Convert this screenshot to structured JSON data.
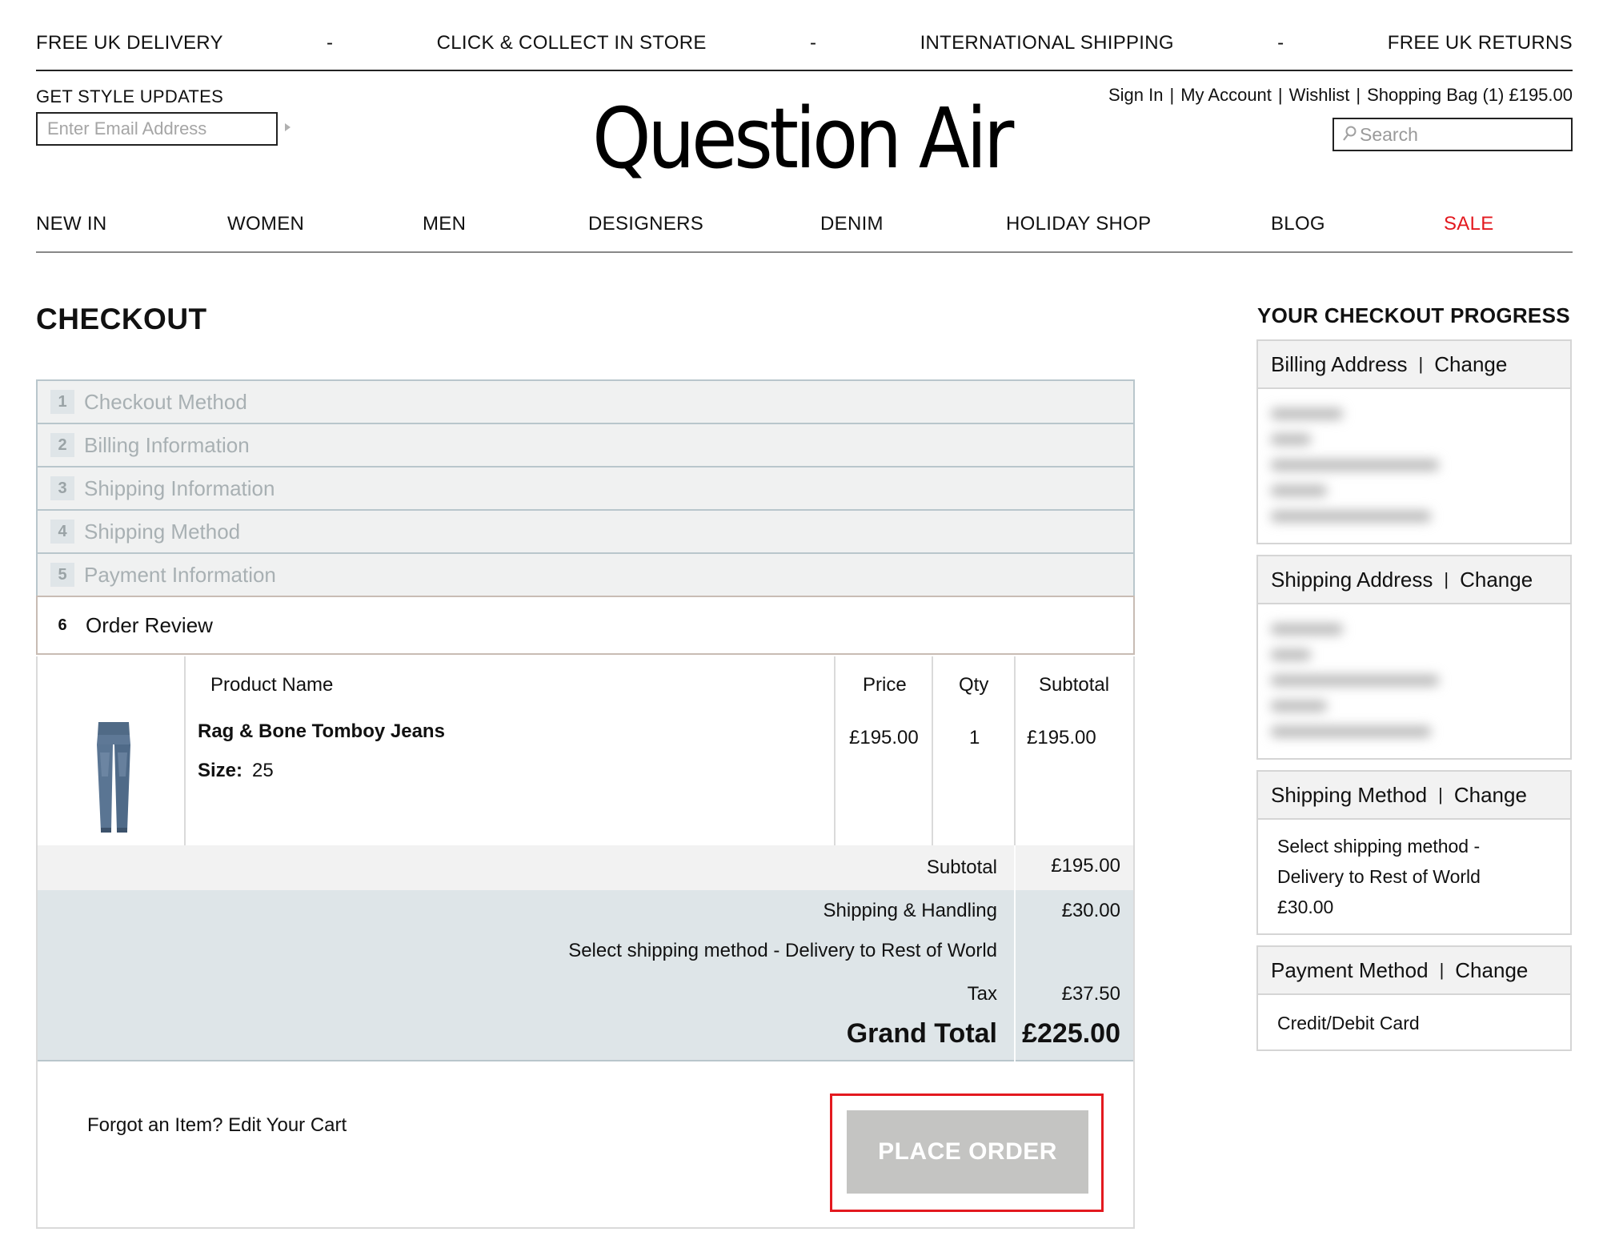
{
  "promo": {
    "items": [
      "FREE UK DELIVERY",
      "CLICK & COLLECT IN STORE",
      "INTERNATIONAL SHIPPING",
      "FREE UK RETURNS"
    ],
    "separator": "-"
  },
  "newsletter": {
    "label": "GET STYLE UPDATES",
    "placeholder": "Enter Email Address"
  },
  "brand": {
    "logo": "Question Air"
  },
  "account": {
    "sign_in": "Sign In",
    "my_account": "My Account",
    "wishlist": "Wishlist",
    "bag": "Shopping Bag (1) £195.00",
    "separator": "|"
  },
  "search": {
    "placeholder": "Search"
  },
  "nav": {
    "items": [
      {
        "label": "NEW IN"
      },
      {
        "label": "WOMEN"
      },
      {
        "label": "MEN"
      },
      {
        "label": "DESIGNERS"
      },
      {
        "label": "DENIM"
      },
      {
        "label": "HOLIDAY SHOP"
      },
      {
        "label": "BLOG"
      },
      {
        "label": "SALE"
      }
    ]
  },
  "checkout": {
    "title": "CHECKOUT",
    "steps": [
      {
        "num": "1",
        "label": "Checkout Method"
      },
      {
        "num": "2",
        "label": "Billing Information"
      },
      {
        "num": "3",
        "label": "Shipping Information"
      },
      {
        "num": "4",
        "label": "Shipping Method"
      },
      {
        "num": "5",
        "label": "Payment Information"
      },
      {
        "num": "6",
        "label": "Order Review"
      }
    ]
  },
  "review": {
    "columns": {
      "product": "Product Name",
      "price": "Price",
      "qty": "Qty",
      "subtotal": "Subtotal"
    },
    "item": {
      "name": "Rag & Bone Tomboy Jeans",
      "size_label": "Size:",
      "size_value": "25",
      "price": "£195.00",
      "qty": "1",
      "subtotal": "£195.00"
    },
    "totals": {
      "subtotal_label": "Subtotal",
      "subtotal_value": "£195.00",
      "shipping_label": "Shipping & Handling",
      "shipping_value": "£30.00",
      "shipping_method": "Select shipping method - Delivery to Rest of World",
      "tax_label": "Tax",
      "tax_value": "£37.50",
      "grand_label": "Grand Total",
      "grand_value": "£225.00"
    },
    "forgot_prefix": "Forgot an Item?",
    "edit_cart": "Edit Your Cart",
    "place_order": "PLACE ORDER"
  },
  "progress": {
    "title": "YOUR CHECKOUT PROGRESS",
    "change_label": "Change",
    "separator": "|",
    "billing_title": "Billing Address",
    "shipping_title": "Shipping Address",
    "method_title": "Shipping Method",
    "method_lines": [
      "Select shipping method -",
      "Delivery to Rest of World",
      "£30.00"
    ],
    "payment_title": "Payment Method",
    "payment_value": "Credit/Debit Card"
  },
  "colors": {
    "sale": "#e3191f",
    "highlight": "#e3191f",
    "button_bg": "#c4c4c2",
    "totals_bg": "#dee5e8"
  }
}
